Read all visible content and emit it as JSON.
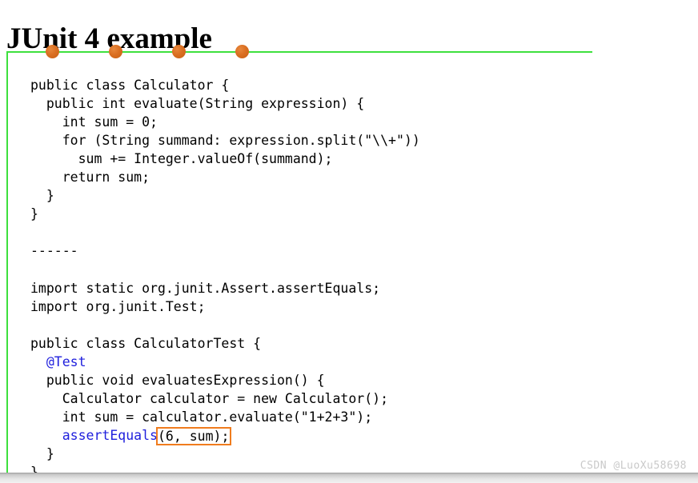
{
  "slide": {
    "title": "JUnit 4 example",
    "frame": {
      "border_color": "#3ee03e",
      "bullet_color": "#da6f22",
      "bullet_count": 4
    }
  },
  "code": {
    "language": "java",
    "keyword_color": "#2020dd",
    "highlight_color": "#f07c1e",
    "text_color": "#000000",
    "lines": [
      {
        "id": "l01",
        "text": "public class Calculator {"
      },
      {
        "id": "l02",
        "text": "  public int evaluate(String expression) {"
      },
      {
        "id": "l03",
        "text": "    int sum = 0;"
      },
      {
        "id": "l04",
        "text": "    for (String summand: expression.split(\"\\\\+\"))"
      },
      {
        "id": "l05",
        "text": "      sum += Integer.valueOf(summand);"
      },
      {
        "id": "l06",
        "text": "    return sum;"
      },
      {
        "id": "l07",
        "text": "  }"
      },
      {
        "id": "l08",
        "text": "}"
      },
      {
        "id": "l09",
        "text": ""
      },
      {
        "id": "l10",
        "text": "------"
      },
      {
        "id": "l11",
        "text": ""
      },
      {
        "id": "l12",
        "text": "import static org.junit.Assert.assertEquals;"
      },
      {
        "id": "l13",
        "text": "import org.junit.Test;"
      },
      {
        "id": "l14",
        "text": ""
      },
      {
        "id": "l15",
        "text": "public class CalculatorTest {"
      },
      {
        "id": "l16_indent",
        "text": "  "
      },
      {
        "id": "l16_annotation",
        "text": "@Test"
      },
      {
        "id": "l17",
        "text": "  public void evaluatesExpression() {"
      },
      {
        "id": "l18",
        "text": "    Calculator calculator = new Calculator();"
      },
      {
        "id": "l19",
        "text": "    int sum = calculator.evaluate(\"1+2+3\");"
      },
      {
        "id": "l20_indent",
        "text": "    "
      },
      {
        "id": "l20_method",
        "text": "assertEquals"
      },
      {
        "id": "l20_args",
        "text": "(6, sum);"
      },
      {
        "id": "l21",
        "text": "  }"
      },
      {
        "id": "l22",
        "text": "}"
      }
    ]
  },
  "watermark": {
    "text": "CSDN @LuoXu58698"
  }
}
